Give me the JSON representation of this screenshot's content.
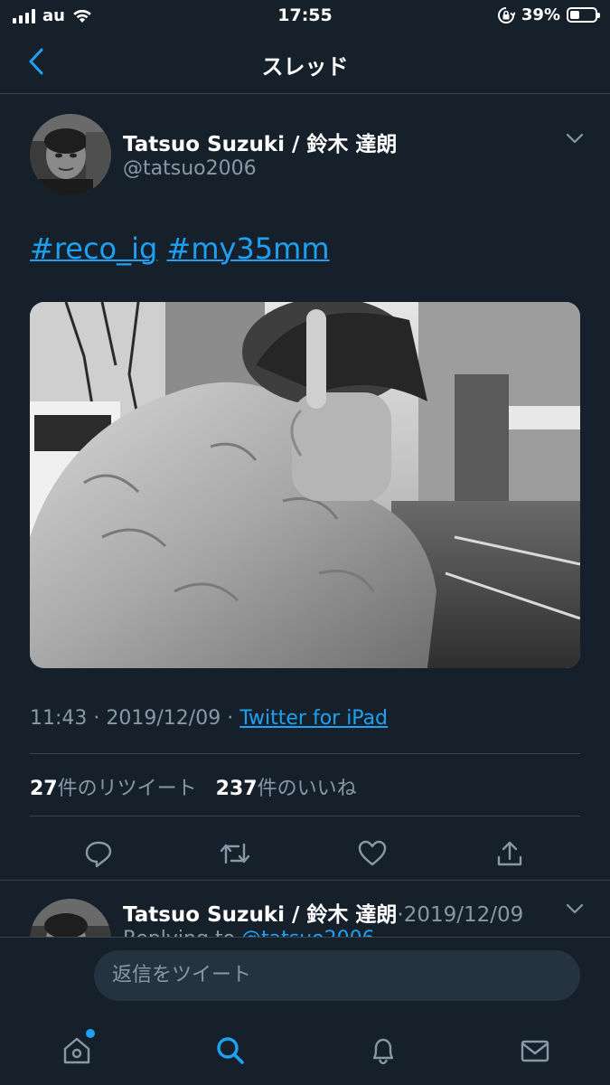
{
  "status_bar": {
    "carrier": "au",
    "time": "17:55",
    "battery_percent": "39%",
    "battery_level": 0.39
  },
  "nav": {
    "title": "スレッド",
    "back_icon": "chevron-left-icon"
  },
  "tweet": {
    "display_name": "Tatsuo Suzuki / 鈴木 達朗",
    "handle": "@tatsuo2006",
    "hashtags": [
      "#reco_ig",
      "#my35mm"
    ],
    "time": "11:43",
    "date": "2019/12/09",
    "source": "Twitter for iPad",
    "retweets_count": "27",
    "retweets_label": "件のリツイート",
    "likes_count": "237",
    "likes_label": "件のいいね",
    "actions": [
      "reply-icon",
      "retweet-icon",
      "like-icon",
      "share-icon"
    ]
  },
  "reply_preview": {
    "display_name": "Tatsuo Suzuki / 鈴木 達朗",
    "date": "2019/12/09",
    "replying_prefix": "Replying to",
    "mention": "@tatsuo2006"
  },
  "reply_bar": {
    "placeholder": "返信をツイート"
  },
  "tabbar": {
    "tabs": [
      "home-icon",
      "search-icon",
      "notifications-icon",
      "messages-icon"
    ],
    "active": "search-icon"
  },
  "colors": {
    "background": "#15202b",
    "accent": "#1da1f2",
    "secondary_text": "#8899a6",
    "divider": "#38444d"
  }
}
